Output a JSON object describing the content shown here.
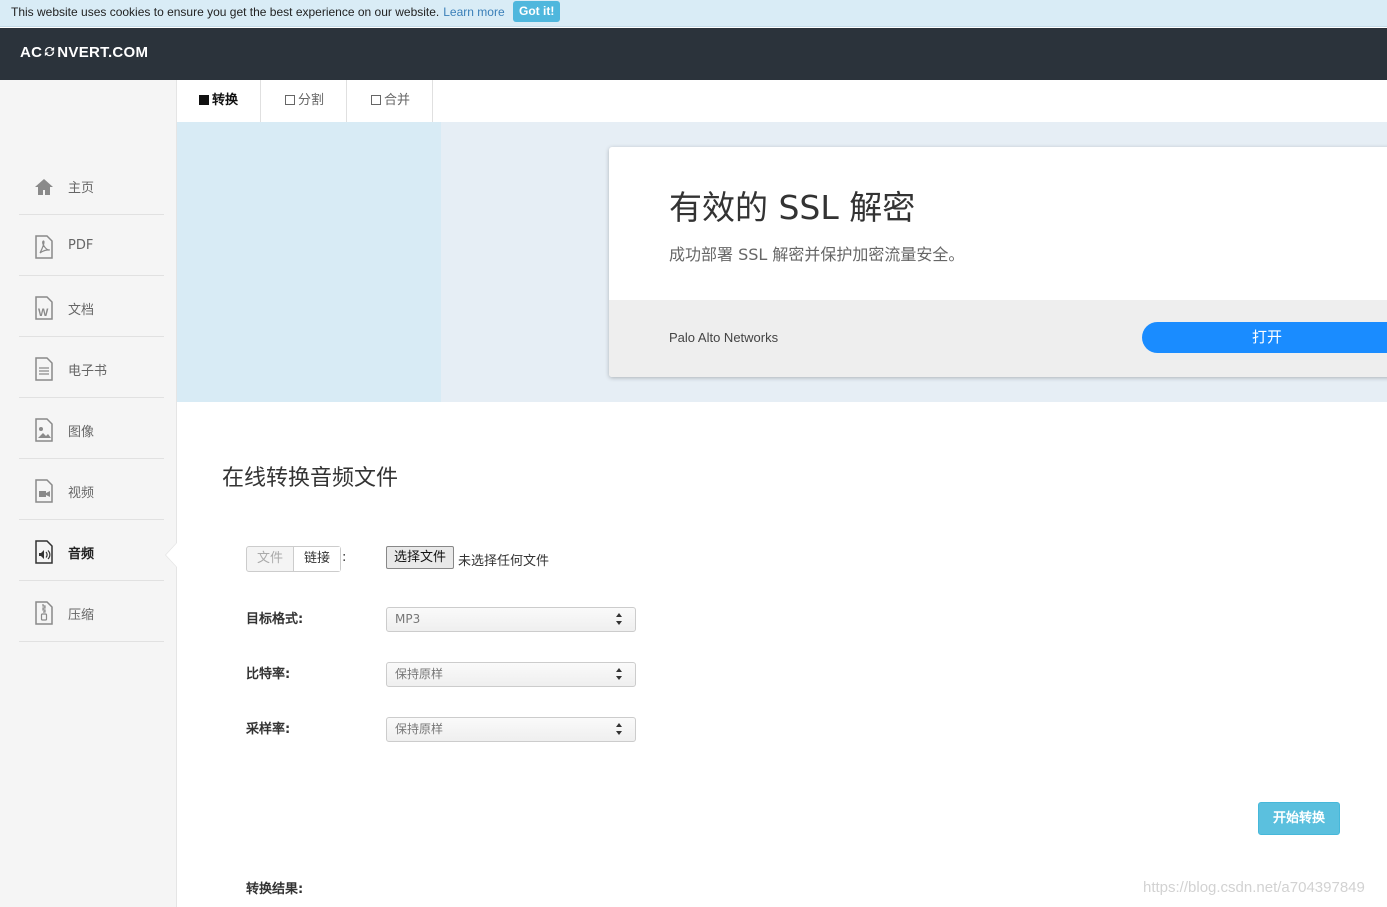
{
  "cookie_bar": {
    "message": "This website uses cookies to ensure you get the best experience on our website.",
    "learn_more": "Learn more",
    "accept": "Got it!"
  },
  "header": {
    "logo_prefix": "AC",
    "logo_suffix": "NVERT.COM"
  },
  "sidebar": {
    "items": [
      {
        "label": "主页",
        "icon": "home-icon"
      },
      {
        "label": "PDF",
        "icon": "pdf-file-icon"
      },
      {
        "label": "文档",
        "icon": "word-document-icon"
      },
      {
        "label": "电子书",
        "icon": "ebook-icon"
      },
      {
        "label": "图像",
        "icon": "image-file-icon"
      },
      {
        "label": "视频",
        "icon": "video-file-icon"
      },
      {
        "label": "音频",
        "icon": "audio-file-icon",
        "active": true
      },
      {
        "label": "压缩",
        "icon": "archive-file-icon"
      }
    ]
  },
  "tabs": [
    {
      "label": "转换",
      "active": true
    },
    {
      "label": "分割",
      "active": false
    },
    {
      "label": "合并",
      "active": false
    }
  ],
  "ad": {
    "title": "有效的 SSL 解密",
    "subtitle": "成功部署 SSL 解密并保护加密流量安全。",
    "brand": "Palo Alto Networks",
    "open_button": "打开"
  },
  "main": {
    "title": "在线转换音频文件",
    "source_tabs": {
      "file": "文件",
      "link": "链接",
      "colon": ":"
    },
    "file_button": "选择文件",
    "file_status": "未选择任何文件",
    "target_format": {
      "label": "目标格式:",
      "value": "MP3"
    },
    "bitrate": {
      "label": "比特率:",
      "value": "保持原样"
    },
    "sample_rate": {
      "label": "采样率:",
      "value": "保持原样"
    },
    "start_button": "开始转换",
    "result_label": "转换结果:"
  },
  "watermark": "https://blog.csdn.net/a704397849",
  "colors": {
    "header_bg": "#2b333b",
    "accent": "#5bc0de",
    "ad_button": "#1a8cff",
    "cookie_bg": "#d9ecf6"
  }
}
